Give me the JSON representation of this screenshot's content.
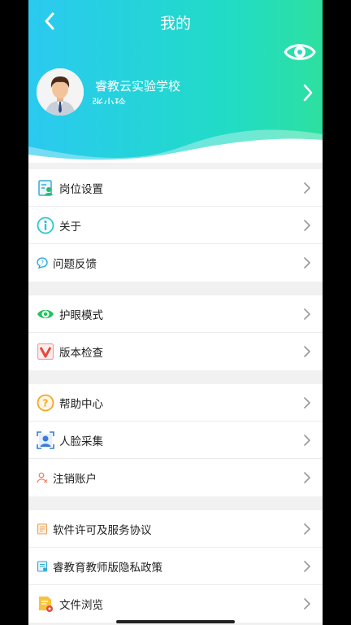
{
  "header": {
    "title": "我的",
    "school": "睿教云实验学校",
    "user_name": "张小玲"
  },
  "colors": {
    "header_gradient_start": "#2bc9f0",
    "header_gradient_end": "#2de0a0",
    "eye_mode_green": "#21c45c"
  },
  "groups": [
    {
      "items": [
        {
          "label": "岗位设置",
          "icon": "position-settings-icon"
        },
        {
          "label": "关于",
          "icon": "info-icon"
        },
        {
          "label": "问题反馈",
          "icon": "feedback-icon"
        }
      ]
    },
    {
      "items": [
        {
          "label": "护眼模式",
          "icon": "eye-icon"
        },
        {
          "label": "版本检查",
          "icon": "version-check-icon"
        }
      ]
    },
    {
      "items": [
        {
          "label": "帮助中心",
          "icon": "help-icon"
        },
        {
          "label": "人脸采集",
          "icon": "face-capture-icon"
        },
        {
          "label": "注销账户",
          "icon": "cancel-account-icon"
        }
      ]
    },
    {
      "items": [
        {
          "label": "软件许可及服务协议",
          "icon": "license-icon"
        },
        {
          "label": "睿教育教师版隐私政策",
          "icon": "privacy-policy-icon"
        },
        {
          "label": "文件浏览",
          "icon": "file-browse-icon"
        }
      ]
    }
  ]
}
